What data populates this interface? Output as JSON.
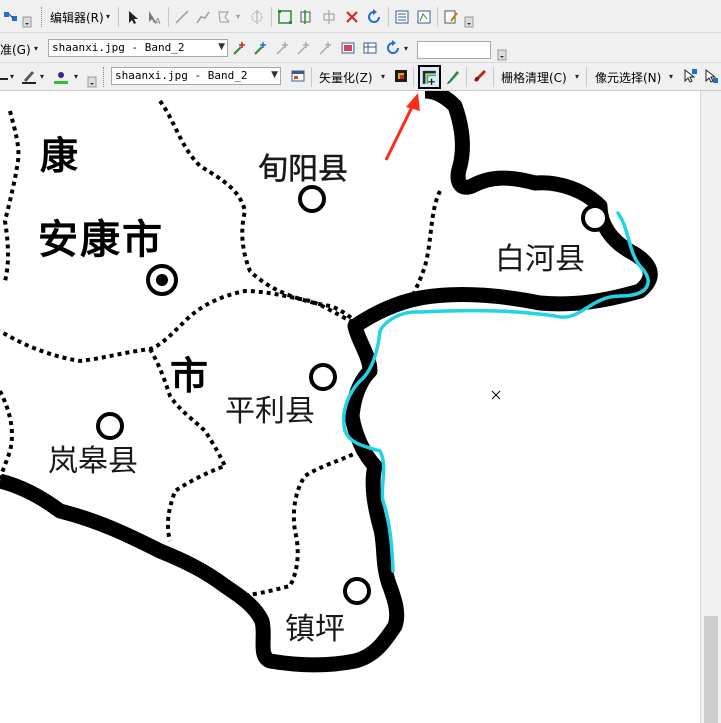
{
  "toolbar1": {
    "editor_label": "编辑器(R)",
    "dropdown_arrow": "▾"
  },
  "toolbar2": {
    "georef_label": "准(G)",
    "layer_combo": "shaanxi.jpg - Band_2",
    "value_field": ""
  },
  "toolbar3": {
    "layer_combo": "shaanxi.jpg - Band_2",
    "vectorize_label": "矢量化(Z)",
    "raster_cleanup_label": "栅格清理(C)",
    "cell_select_label": "像元选择(N)"
  },
  "map": {
    "city_label": "安康市",
    "kang_label": "康",
    "shi_label": "市",
    "county_labels": [
      "旬阳县",
      "白河县",
      "平利县",
      "岚皋县",
      "镇坪"
    ],
    "trace_color": "#22d3e6",
    "arrow_color": "#ff2a1a"
  },
  "status": {
    "cursor_icon": "cross-cursor-icon"
  }
}
